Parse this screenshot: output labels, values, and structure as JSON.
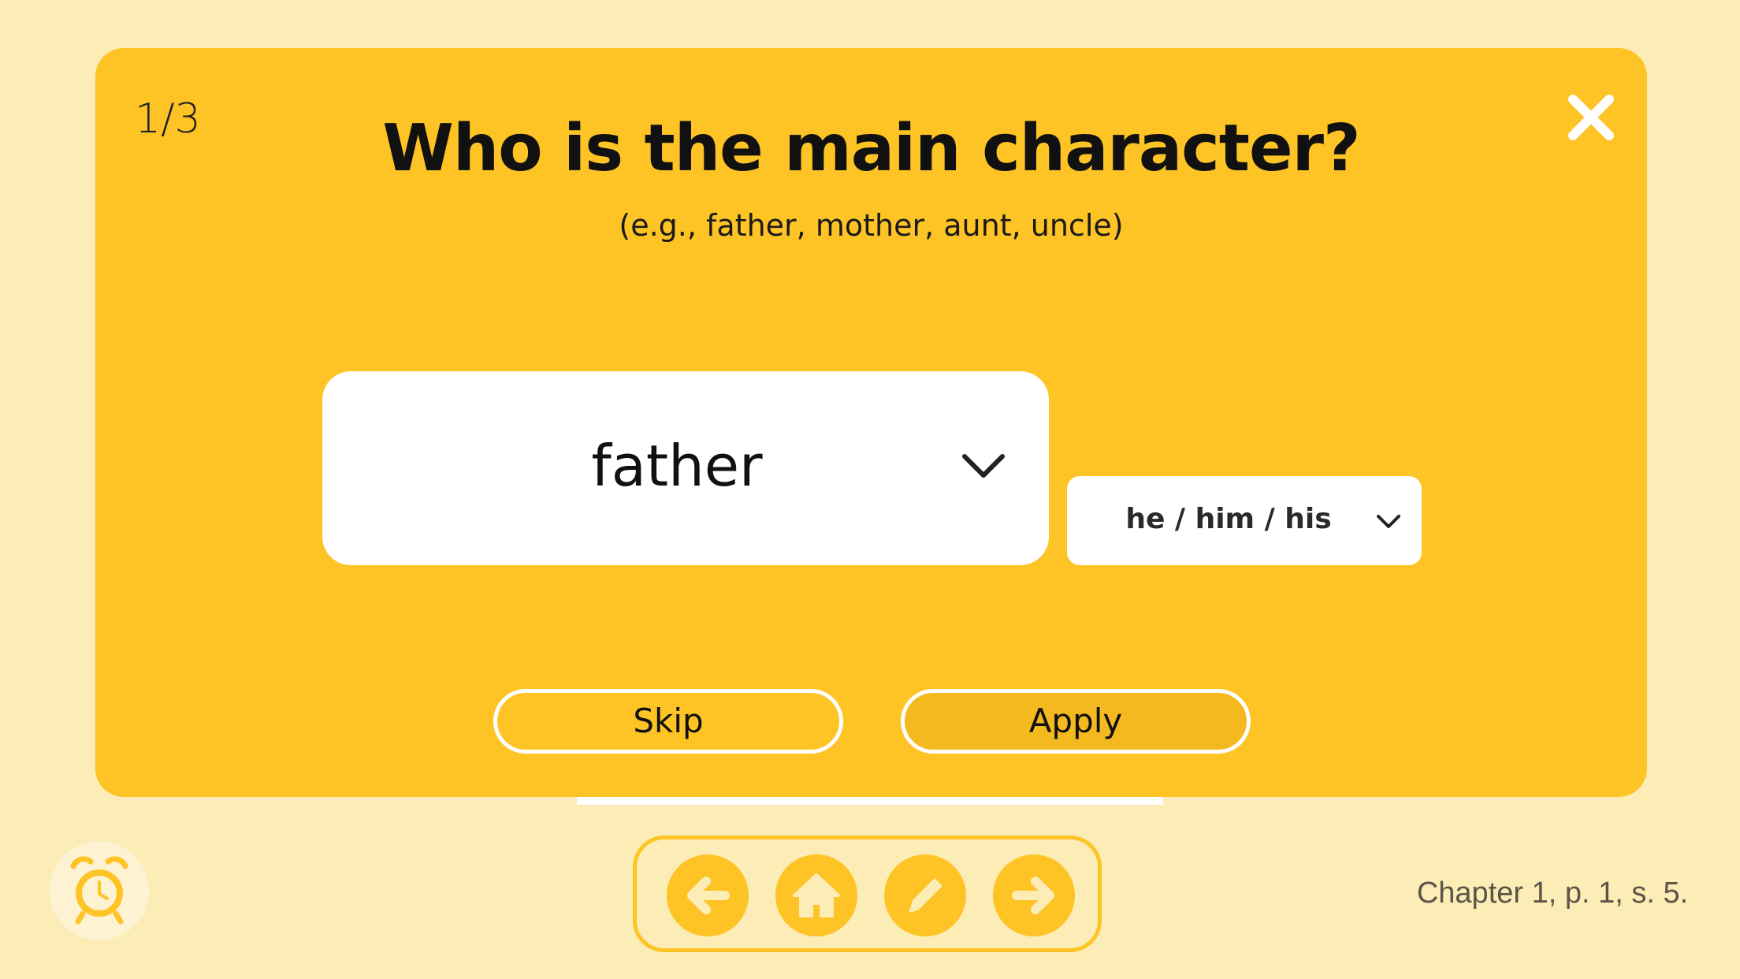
{
  "modal": {
    "step_counter": "1/3",
    "title": "Who is the main character?",
    "subtitle": "(e.g., father, mother, aunt, uncle)",
    "close_icon": "close-icon",
    "character_select": {
      "value": "father",
      "icon": "chevron-down-icon"
    },
    "pronoun_select": {
      "value": "he / him / his",
      "icon": "chevron-down-icon"
    },
    "skip_label": "Skip",
    "apply_label": "Apply"
  },
  "toolbar": {
    "alarm_icon": "alarm-clock-icon",
    "nav_buttons": [
      {
        "icon": "arrow-left-icon"
      },
      {
        "icon": "home-icon"
      },
      {
        "icon": "pencil-icon"
      },
      {
        "icon": "arrow-right-icon"
      }
    ]
  },
  "page_info": "Chapter 1, p. 1, s. 5.",
  "colors": {
    "background": "#fcecb5",
    "accent": "#fec325",
    "apply_button": "#f3b91f",
    "white": "#ffffff"
  }
}
